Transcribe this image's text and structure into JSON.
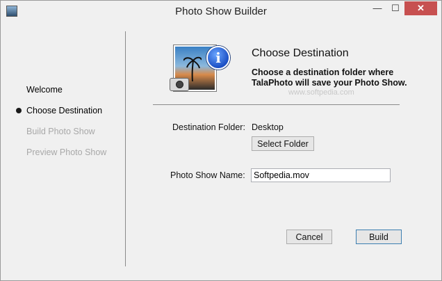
{
  "window": {
    "title": "Photo Show Builder",
    "controls": {
      "minimize": "—",
      "maximize": "☐",
      "close": "✕"
    }
  },
  "sidebar": {
    "steps": [
      {
        "label": "Welcome",
        "state": "done"
      },
      {
        "label": "Choose Destination",
        "state": "active"
      },
      {
        "label": "Build Photo Show",
        "state": "inactive"
      },
      {
        "label": "Preview Photo Show",
        "state": "inactive"
      }
    ]
  },
  "header": {
    "heading": "Choose Destination",
    "description": "Choose a destination folder where TalaPhoto will save your Photo Show.",
    "watermark": "www.softpedia.com",
    "icon_names": [
      "photo-icon",
      "info-icon",
      "camera-icon"
    ]
  },
  "form": {
    "folder_label": "Destination Folder:",
    "folder_value": "Desktop",
    "select_folder_button": "Select Folder",
    "name_label": "Photo Show Name:",
    "name_value": "Softpedia.mov"
  },
  "footer": {
    "cancel_button": "Cancel",
    "build_button": "Build"
  },
  "colors": {
    "close_button": "#c75050",
    "inactive_step": "#a8a8a8",
    "default_button_border": "#3c7fb1"
  }
}
